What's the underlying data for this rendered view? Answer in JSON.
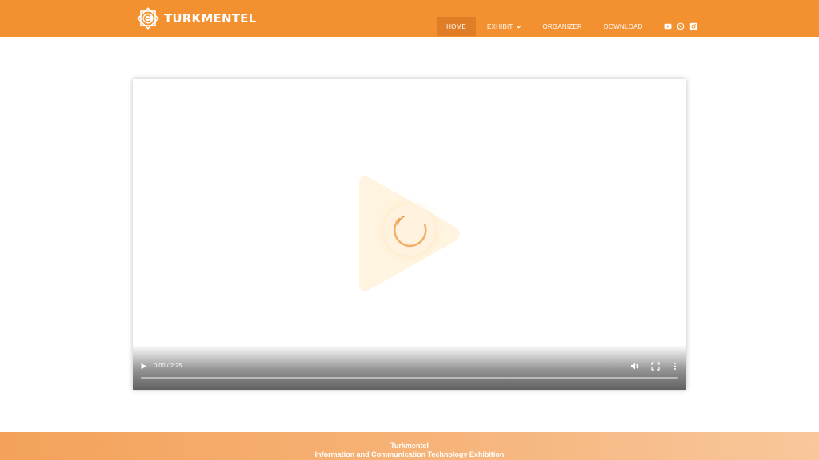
{
  "brand": {
    "name": "TURKMENTEL",
    "logo_icon": "octagram-logo-icon",
    "header_color": "#f39130"
  },
  "nav": {
    "items": [
      {
        "label": "HOME",
        "active": true
      },
      {
        "label": "EXHIBIT",
        "has_dropdown": true
      },
      {
        "label": "ORGANIZER"
      },
      {
        "label": "DOWNLOAD"
      }
    ],
    "social": [
      "youtube-icon",
      "whatsapp-icon",
      "instagram-icon"
    ]
  },
  "video": {
    "time": "0:00 / 2:25",
    "progress_fraction": 0,
    "overlay_icon": "play-triangle-icon",
    "loading_icon": "spinner-icon",
    "controls": [
      "play-icon",
      "volume-icon",
      "fullscreen-icon",
      "more-options-icon"
    ]
  },
  "footer": {
    "title": "Turkmentel",
    "subtitle": "Information and Communication Technology Exhibition"
  }
}
